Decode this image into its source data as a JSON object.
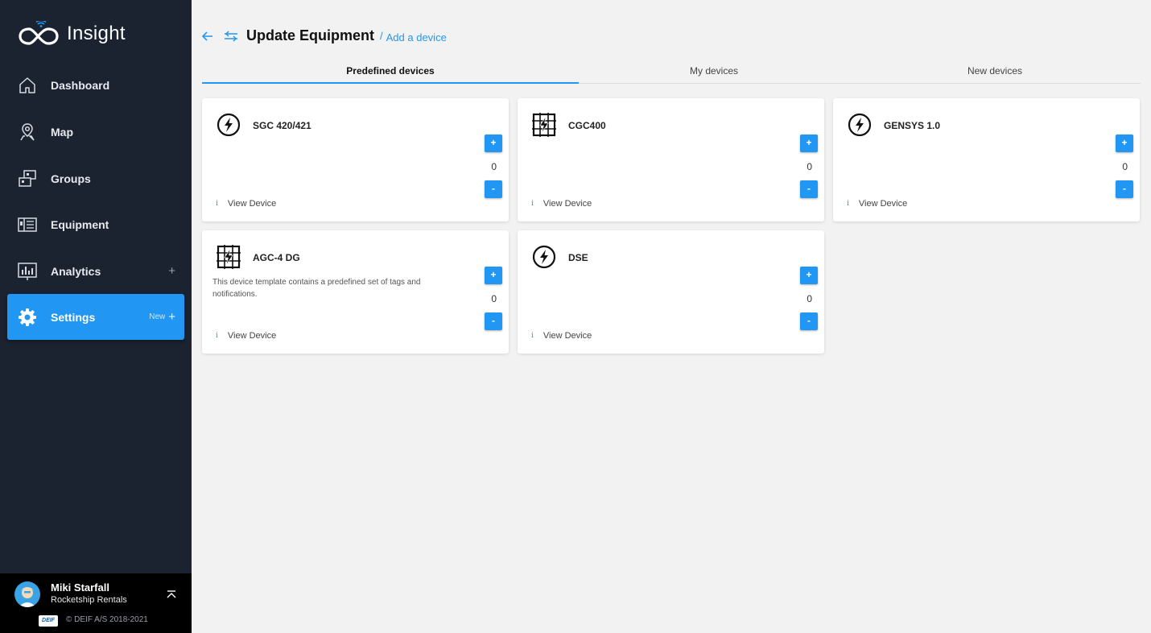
{
  "app": {
    "name": "Insight",
    "colors": {
      "sidebar": "#1b2230",
      "accent": "#2196f3",
      "background": "#f2f2f2"
    }
  },
  "nav": {
    "items": [
      {
        "label": "Dashboard",
        "icon": "home-icon"
      },
      {
        "label": "Map",
        "icon": "map-pin-icon"
      },
      {
        "label": "Groups",
        "icon": "groups-icon"
      },
      {
        "label": "Equipment",
        "icon": "equipment-icon"
      },
      {
        "label": "Analytics",
        "icon": "analytics-icon",
        "plus": "+"
      },
      {
        "label": "Settings",
        "icon": "gear-icon",
        "badge": "New",
        "plus": "+",
        "active": true
      }
    ]
  },
  "user": {
    "name": "Miki Starfall",
    "org": "Rocketship Rentals",
    "logo_text": "DEIF",
    "copyright": "© DEIF A/S 2018-2021"
  },
  "header": {
    "title": "Update Equipment",
    "separator": "/",
    "breadcrumb": "Add a device"
  },
  "tabs": [
    {
      "label": "Predefined devices",
      "active": true
    },
    {
      "label": "My devices"
    },
    {
      "label": "New devices"
    }
  ],
  "devices": [
    {
      "name": "SGC 420/421",
      "icon": "lightning-circle-icon",
      "description": "",
      "qty": "0",
      "plus": "+",
      "minus": "-",
      "info": "i",
      "view": "View Device"
    },
    {
      "name": "CGC400",
      "icon": "lightning-grid-icon",
      "description": "",
      "qty": "0",
      "plus": "+",
      "minus": "-",
      "info": "i",
      "view": "View Device"
    },
    {
      "name": "GENSYS 1.0",
      "icon": "lightning-circle-icon",
      "description": "",
      "qty": "0",
      "plus": "+",
      "minus": "-",
      "info": "i",
      "view": "View Device"
    },
    {
      "name": "AGC-4 DG",
      "icon": "lightning-grid-icon",
      "description": "This device template contains a predefined set of tags and notifications.",
      "qty": "0",
      "plus": "+",
      "minus": "-",
      "info": "i",
      "view": "View Device"
    },
    {
      "name": "DSE",
      "icon": "lightning-circle-icon",
      "description": "",
      "qty": "0",
      "plus": "+",
      "minus": "-",
      "info": "i",
      "view": "View Device"
    }
  ]
}
